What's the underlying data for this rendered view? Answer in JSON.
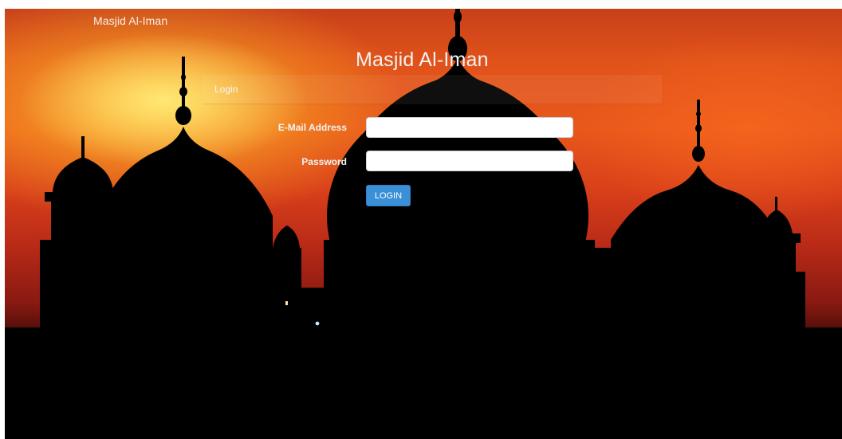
{
  "navbar": {
    "brand": "Masjid Al-Iman"
  },
  "page": {
    "title": "Masjid Al-Iman"
  },
  "login_panel": {
    "heading": "Login",
    "email_label": "E-Mail Address",
    "email_value": "",
    "password_label": "Password",
    "password_value": "",
    "submit_label": "LOGIN"
  },
  "background": {
    "subject": "mosque silhouette at sunset"
  },
  "colors": {
    "button": "#3a8fd6",
    "sky_top": "#e0521a",
    "sky_glow": "#ffdd66",
    "silhouette": "#000000"
  }
}
